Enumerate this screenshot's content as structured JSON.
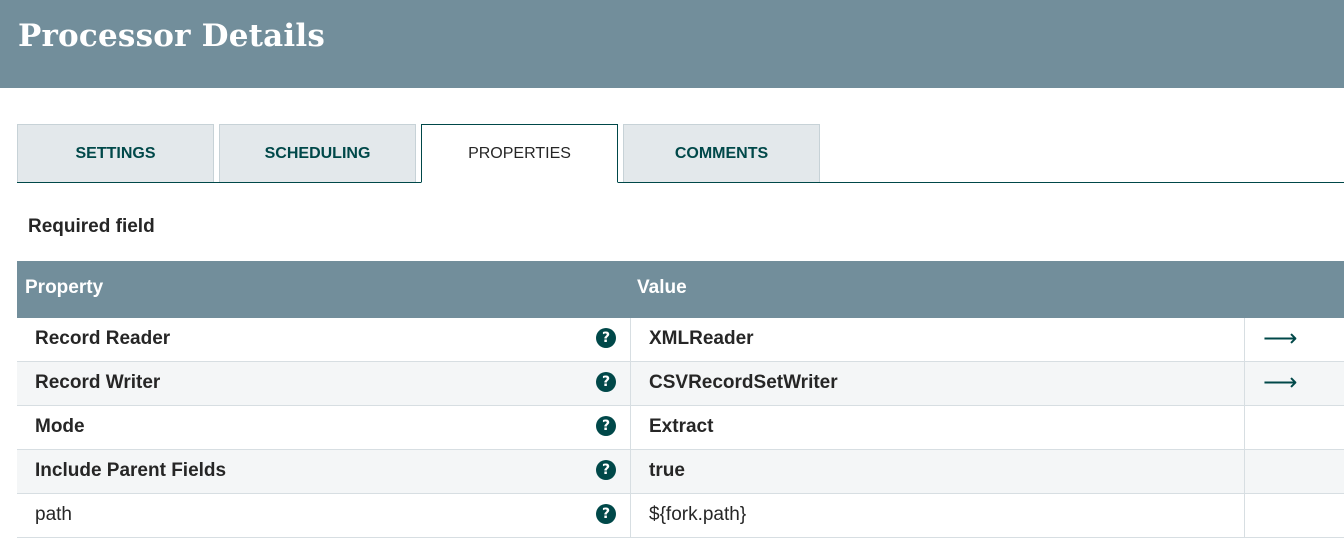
{
  "header": {
    "title": "Processor Details"
  },
  "tabs": [
    {
      "label": "SETTINGS",
      "active": false
    },
    {
      "label": "SCHEDULING",
      "active": false
    },
    {
      "label": "PROPERTIES",
      "active": true
    },
    {
      "label": "COMMENTS",
      "active": false
    }
  ],
  "required_label": "Required field",
  "grid": {
    "columns": {
      "property": "Property",
      "value": "Value"
    },
    "rows": [
      {
        "property": "Record Reader",
        "value": "XMLReader",
        "required": true,
        "has_link": true
      },
      {
        "property": "Record Writer",
        "value": "CSVRecordSetWriter",
        "required": true,
        "has_link": true
      },
      {
        "property": "Mode",
        "value": "Extract",
        "required": true,
        "has_link": false
      },
      {
        "property": "Include Parent Fields",
        "value": "true",
        "required": true,
        "has_link": false
      },
      {
        "property": "path",
        "value": "${fork.path}",
        "required": false,
        "has_link": false
      }
    ]
  },
  "icons": {
    "help": "?",
    "goto": "⟶"
  },
  "colors": {
    "header_bg": "#728e9b",
    "accent": "#004849",
    "tab_bg": "#e3e8eb"
  }
}
